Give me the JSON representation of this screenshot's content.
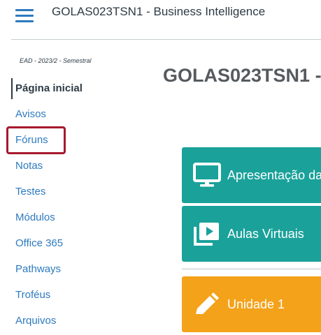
{
  "header": {
    "title": "GOLAS023TSN1 - Business Intelligence"
  },
  "sidebar": {
    "term": "EAD - 2023/2 - Semestral",
    "items": [
      {
        "label": "Página inicial"
      },
      {
        "label": "Avisos"
      },
      {
        "label": "Fóruns"
      },
      {
        "label": "Notas"
      },
      {
        "label": "Testes"
      },
      {
        "label": "Módulos"
      },
      {
        "label": "Office 365"
      },
      {
        "label": "Pathways"
      },
      {
        "label": "Troféus"
      },
      {
        "label": "Arquivos"
      }
    ]
  },
  "main": {
    "course_title": "GOLAS023TSN1 -",
    "tiles": [
      {
        "label": "Apresentação da",
        "icon": "monitor-icon",
        "color": "#1aa19a"
      },
      {
        "label": "Aulas Virtuais",
        "icon": "video-library-icon",
        "color": "#1aa19a"
      },
      {
        "label": "Unidade 1",
        "icon": "pencil-icon",
        "color": "#f4a21a"
      }
    ]
  },
  "colors": {
    "link": "#2d7abf",
    "text": "#2d3b45",
    "highlight_border": "#a6192e"
  }
}
